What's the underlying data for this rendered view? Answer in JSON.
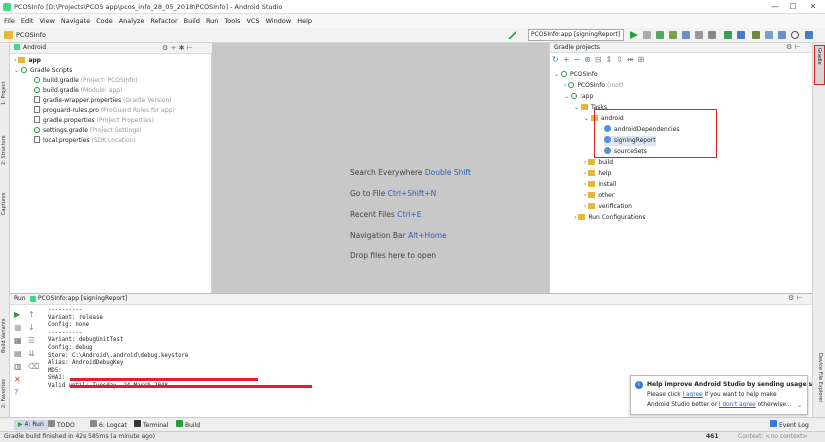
{
  "window": {
    "title": "PCOSInfo [D:\\Projects\\PCOS app\\pcos_info_28_05_2018\\PCOSInfo] - Android Studio",
    "min": "—",
    "max": "☐",
    "close": "✕"
  },
  "menu": [
    "File",
    "Edit",
    "View",
    "Navigate",
    "Code",
    "Analyze",
    "Refactor",
    "Build",
    "Run",
    "Tools",
    "VCS",
    "Window",
    "Help"
  ],
  "navbar": {
    "crumb": "PCOSInfo",
    "run_config": "PCOSInfo:app [signingReport]"
  },
  "left_tabs": [
    "1: Project",
    "2: Structure",
    "Captures"
  ],
  "project": {
    "view_selector": "Android",
    "items": [
      {
        "label": "app",
        "hint": "",
        "type": "folder",
        "bold": true
      },
      {
        "label": "Gradle Scripts",
        "hint": "",
        "type": "gradle"
      },
      {
        "label": "build.gradle",
        "hint": "(Project: PCOSInfo)",
        "type": "gradle"
      },
      {
        "label": "build.gradle",
        "hint": "(Module: app)",
        "type": "gradle"
      },
      {
        "label": "gradle-wrapper.properties",
        "hint": "(Gradle Version)",
        "type": "doc"
      },
      {
        "label": "proguard-rules.pro",
        "hint": "(ProGuard Rules for app)",
        "type": "doc"
      },
      {
        "label": "gradle.properties",
        "hint": "(Project Properties)",
        "type": "doc"
      },
      {
        "label": "settings.gradle",
        "hint": "(Project Settings)",
        "type": "gradle"
      },
      {
        "label": "local.properties",
        "hint": "(SDK Location)",
        "type": "doc"
      }
    ]
  },
  "editor": {
    "lines": [
      {
        "text": "Search Everywhere",
        "key": "Double Shift"
      },
      {
        "text": "Go to File",
        "key": "Ctrl+Shift+N"
      },
      {
        "text": "Recent Files",
        "key": "Ctrl+E"
      },
      {
        "text": "Navigation Bar",
        "key": "Alt+Home"
      },
      {
        "text": "Drop files here to open",
        "key": ""
      }
    ]
  },
  "gradle": {
    "title": "Gradle projects",
    "items": [
      {
        "label": "PCOSInfo",
        "hint": ""
      },
      {
        "label": "PCOSInfo",
        "hint": "(root)"
      },
      {
        "label": ":app",
        "hint": ""
      },
      {
        "label": "Tasks",
        "hint": ""
      },
      {
        "label": "android",
        "hint": ""
      },
      {
        "label": "androidDependencies",
        "hint": ""
      },
      {
        "label": "signingReport",
        "hint": ""
      },
      {
        "label": "sourceSets",
        "hint": ""
      },
      {
        "label": "build",
        "hint": ""
      },
      {
        "label": "help",
        "hint": ""
      },
      {
        "label": "install",
        "hint": ""
      },
      {
        "label": "other",
        "hint": ""
      },
      {
        "label": "verification",
        "hint": ""
      },
      {
        "label": "Run Configurations",
        "hint": ""
      }
    ]
  },
  "right_tabs": [
    "Gradle",
    "Device File Explorer"
  ],
  "run": {
    "label": "Run",
    "tab": "PCOSInfo:app [signingReport]",
    "console": [
      "----------",
      "Variant: release",
      "Config: none",
      "----------",
      "Variant: debugUnitTest",
      "Config: debug",
      "Store: C:\\Android\\.android\\debug.keystore",
      "Alias: AndroidDebugKey",
      "MD5:",
      "SHA1:",
      "Valid until: Tuesday, 24 March 2048"
    ]
  },
  "left_bottom_tabs": [
    "Build Variants",
    "2: Favorites"
  ],
  "notification": {
    "title": "Help improve Android Studio by sending usage s",
    "line1_a": "Please click",
    "line1_link": "I agree",
    "line1_b": "if you want to help make",
    "line2_a": "Android Studio better or",
    "line2_link": "I don't agree",
    "line2_b": "otherwise..."
  },
  "bottom_tabs": [
    "4: Run",
    "TODO",
    "6: Logcat",
    "Terminal",
    "Build"
  ],
  "event_log": "Event Log",
  "status": {
    "message": "Gradle build finished in 42s 585ms (a minute ago)",
    "position": "461",
    "context": "Context: <no context>"
  },
  "colors": {
    "accent": "#2b9d3a",
    "highlight": "#e02020",
    "link": "#2d5fb3"
  }
}
